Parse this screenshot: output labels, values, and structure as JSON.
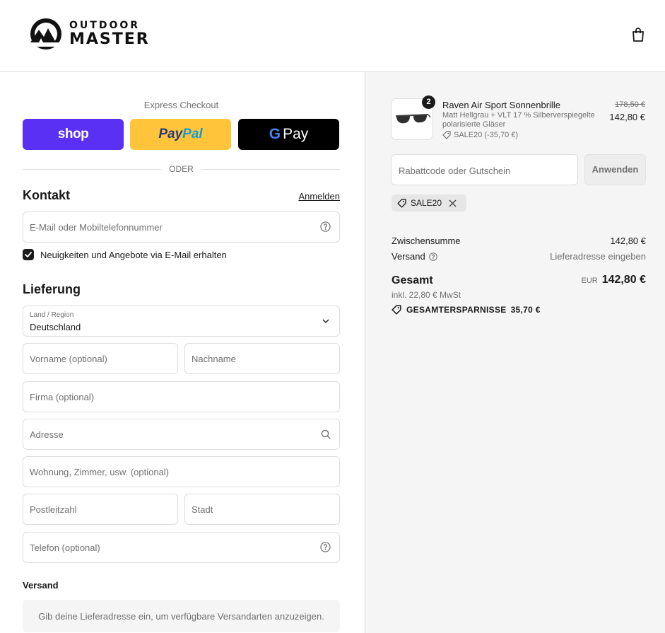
{
  "brand": {
    "line1": "OUTDOOR",
    "line2": "MASTER"
  },
  "icons": {
    "cart": "shopping-bag-icon",
    "help": "question-circle-icon",
    "search": "search-icon",
    "chevron": "chevron-down-icon",
    "tag": "tag-icon",
    "close": "close-icon",
    "check": "check-icon"
  },
  "express": {
    "title": "Express Checkout",
    "shop_label": "shop",
    "paypal_label_a": "Pay",
    "paypal_label_b": "Pal",
    "gpay_g": "G",
    "gpay_label": "Pay",
    "divider": "ODER"
  },
  "contact": {
    "title": "Kontakt",
    "login": "Anmelden",
    "email_placeholder": "E-Mail oder Mobiltelefonnummer",
    "newsletter_label": "Neuigkeiten und Angebote via E-Mail erhalten",
    "newsletter_checked": true
  },
  "delivery": {
    "title": "Lieferung",
    "country_label": "Land / Region",
    "country_value": "Deutschland",
    "first_name": "Vorname (optional)",
    "last_name": "Nachname",
    "company": "Firma (optional)",
    "address": "Adresse",
    "apartment": "Wohnung, Zimmer, usw. (optional)",
    "zip": "Postleitzahl",
    "city": "Stadt",
    "phone": "Telefon (optional)"
  },
  "shipping": {
    "title": "Versand",
    "notice": "Gib deine Lieferadresse ein, um verfügbare Versandarten anzuzeigen."
  },
  "order": {
    "item": {
      "quantity": "2",
      "name": "Raven Air Sport Sonnenbrille",
      "variant": "Matt Hellgrau + VLT 17 % Silberverspiegelte polarisierte Gläser",
      "discount": "SALE20 (-35,70 €)",
      "old_price": "178,50 €",
      "price": "142,80 €"
    },
    "code_placeholder": "Rabattcode oder Gutschein",
    "apply_label": "Anwenden",
    "applied_code": "SALE20",
    "subtotal_label": "Zwischensumme",
    "subtotal_value": "142,80 €",
    "shipping_label": "Versand",
    "shipping_value": "Lieferadresse eingeben",
    "total_label": "Gesamt",
    "currency": "EUR",
    "total_value": "142,80 €",
    "tax_line": "inkl. 22,80 € MwSt",
    "savings_label": "GESAMTERSPARNISSE",
    "savings_value": "35,70 €"
  },
  "colors": {
    "shop": "#5a31f4",
    "paypal": "#ffc439",
    "gpay": "#000000",
    "border": "#dedede",
    "summary_bg": "#f5f5f5"
  }
}
